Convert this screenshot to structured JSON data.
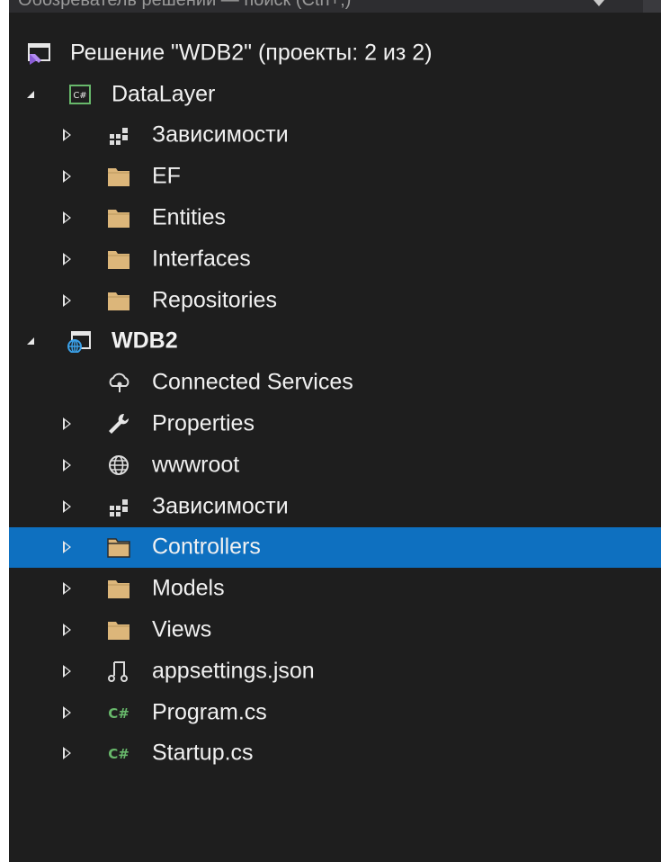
{
  "header": {
    "title": "Обозреватель решений — поиск (Ctrl+;)"
  },
  "colors": {
    "background": "#1e1e1e",
    "selection": "#0e70c0",
    "text": "#f1f1f1",
    "folder": "#dcb67a",
    "csharp": "#68b86b"
  },
  "tree": {
    "solution": {
      "label": "Решение \"WDB2\" (проекты: 2 из 2)",
      "icon": "vs-solution-icon"
    },
    "datalayer": {
      "label": "DataLayer",
      "icon": "csharp-project-icon",
      "items": [
        {
          "label": "Зависимости",
          "icon": "dependencies-icon"
        },
        {
          "label": "EF",
          "icon": "folder-icon"
        },
        {
          "label": "Entities",
          "icon": "folder-icon"
        },
        {
          "label": "Interfaces",
          "icon": "folder-icon"
        },
        {
          "label": "Repositories",
          "icon": "folder-icon"
        }
      ]
    },
    "wdb2": {
      "label": "WDB2",
      "icon": "web-project-icon",
      "items": [
        {
          "label": "Connected Services",
          "icon": "connected-services-icon"
        },
        {
          "label": "Properties",
          "icon": "wrench-icon"
        },
        {
          "label": "wwwroot",
          "icon": "globe-icon"
        },
        {
          "label": "Зависимости",
          "icon": "dependencies-icon"
        },
        {
          "label": "Controllers",
          "icon": "folder-icon",
          "selected": true
        },
        {
          "label": "Models",
          "icon": "folder-icon"
        },
        {
          "label": "Views",
          "icon": "folder-icon"
        },
        {
          "label": "appsettings.json",
          "icon": "json-file-icon"
        },
        {
          "label": "Program.cs",
          "icon": "csharp-file-icon"
        },
        {
          "label": "Startup.cs",
          "icon": "csharp-file-icon"
        }
      ]
    }
  }
}
